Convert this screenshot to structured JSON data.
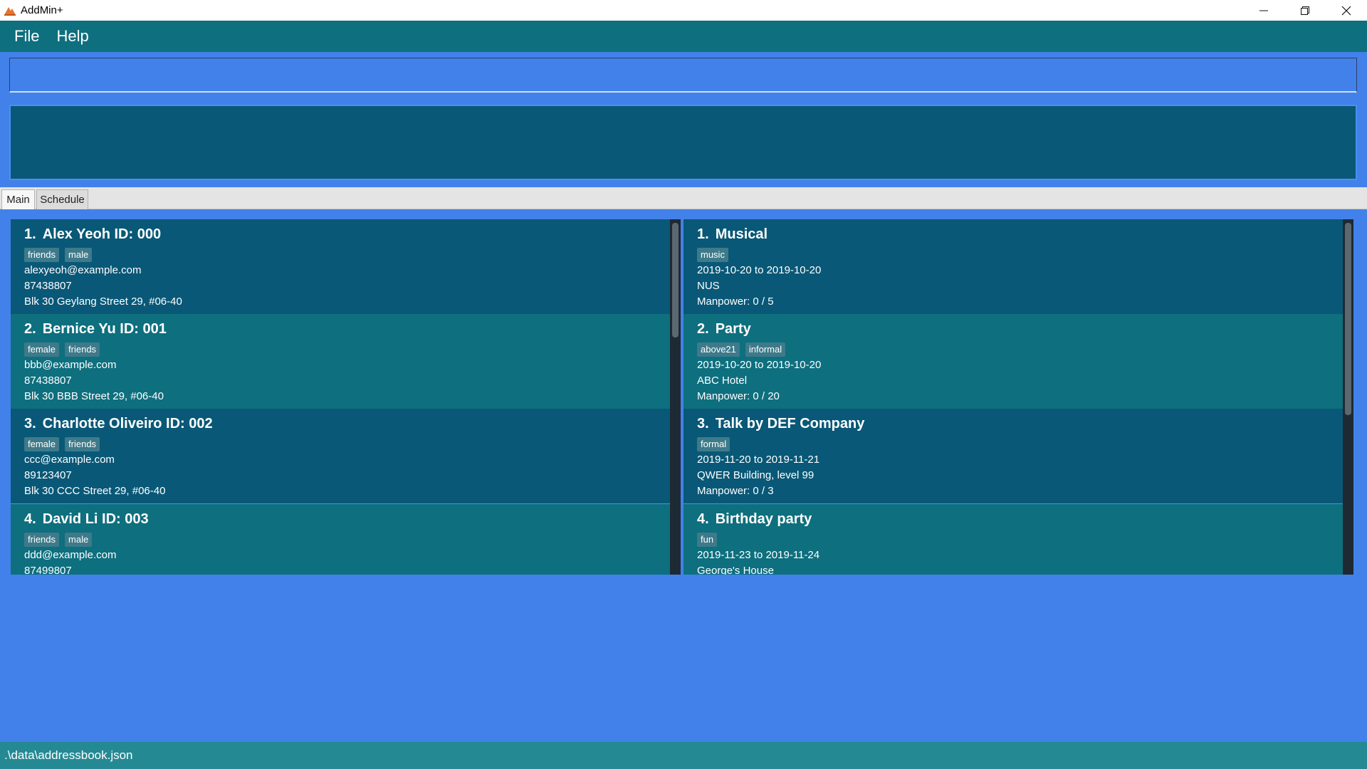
{
  "window": {
    "title": "AddMin+"
  },
  "menu": {
    "file": "File",
    "help": "Help"
  },
  "command": {
    "value": "",
    "placeholder": ""
  },
  "result": {
    "text": ""
  },
  "tabs": [
    {
      "label": "Main"
    },
    {
      "label": "Schedule"
    }
  ],
  "status": {
    "path": ".\\data\\addressbook.json"
  },
  "persons": [
    {
      "index": "1.",
      "name": "Alex Yeoh ID: 000",
      "tags": [
        "friends",
        "male"
      ],
      "email": "alexyeoh@example.com",
      "phone": "87438807",
      "address": "Blk 30 Geylang Street 29, #06-40"
    },
    {
      "index": "2.",
      "name": "Bernice Yu ID: 001",
      "tags": [
        "female",
        "friends"
      ],
      "email": "bbb@example.com",
      "phone": "87438807",
      "address": "Blk 30 BBB Street 29, #06-40"
    },
    {
      "index": "3.",
      "name": "Charlotte Oliveiro ID: 002",
      "tags": [
        "female",
        "friends"
      ],
      "email": "ccc@example.com",
      "phone": "89123407",
      "address": "Blk 30 CCC Street 29, #06-40"
    },
    {
      "index": "4.",
      "name": "David Li ID: 003",
      "tags": [
        "friends",
        "male"
      ],
      "email": "ddd@example.com",
      "phone": "87499807",
      "address": ""
    }
  ],
  "events": [
    {
      "index": "1.",
      "name": "Musical",
      "tags": [
        "music"
      ],
      "dates": "2019-10-20 to 2019-10-20",
      "venue": "NUS",
      "manpower": "Manpower: 0 / 5"
    },
    {
      "index": "2.",
      "name": "Party",
      "tags": [
        "above21",
        "informal"
      ],
      "dates": "2019-10-20 to 2019-10-20",
      "venue": "ABC Hotel",
      "manpower": "Manpower: 0 / 20"
    },
    {
      "index": "3.",
      "name": "Talk by DEF Company",
      "tags": [
        "formal"
      ],
      "dates": "2019-11-20 to 2019-11-21",
      "venue": "QWER Building, level 99",
      "manpower": "Manpower: 0 / 3"
    },
    {
      "index": "4.",
      "name": "Birthday party",
      "tags": [
        "fun"
      ],
      "dates": "2019-11-23 to 2019-11-24",
      "venue": "George's House",
      "manpower": ""
    }
  ],
  "icons": {
    "app": "addmin-app-icon",
    "minimize": "minimize-icon",
    "restore": "restore-icon",
    "close": "close-icon"
  }
}
